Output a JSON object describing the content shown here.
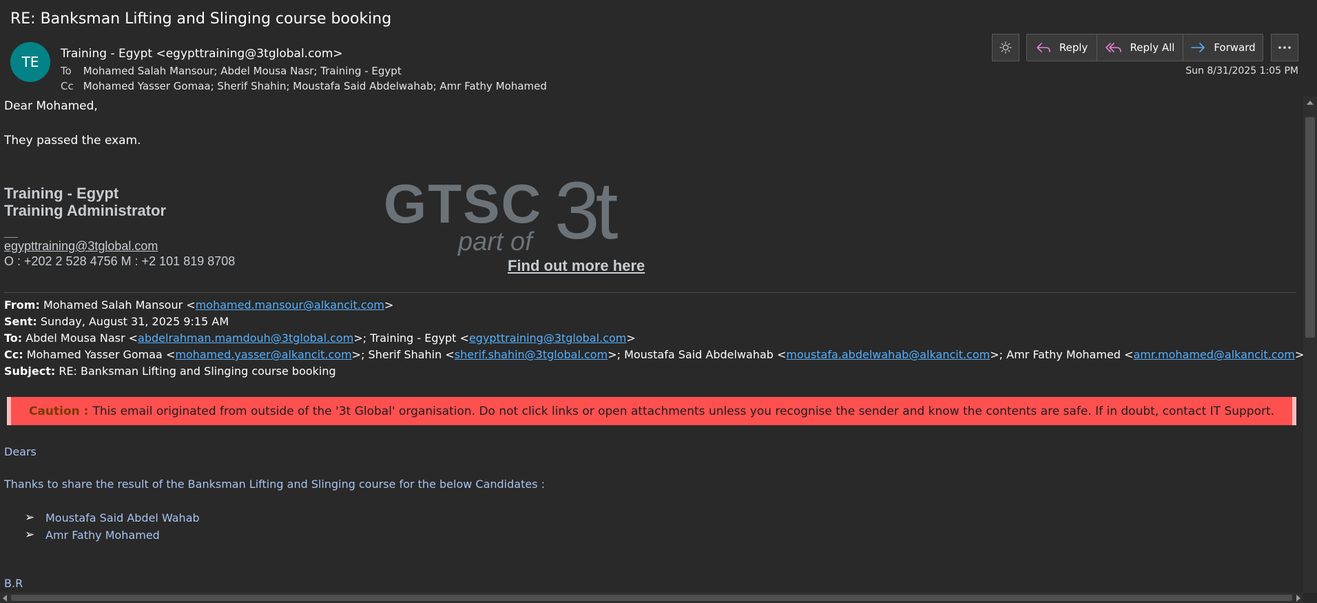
{
  "header": {
    "subject": "RE: Banksman Lifting and Slinging course booking",
    "avatar_initials": "TE",
    "avatar_color": "#038387",
    "from": "Training - Egypt <egypttraining@3tglobal.com>",
    "to_label": "To",
    "to": "Mohamed Salah Mansour; Abdel Mousa Nasr; Training - Egypt",
    "cc_label": "Cc",
    "cc": "Mohamed Yasser Gomaa; Sherif Shahin; Moustafa Said Abdelwahab; Amr Fathy Mohamed",
    "date": "Sun 8/31/2025 1:05 PM"
  },
  "actions": {
    "theme_icon": "sun-icon",
    "reply": "Reply",
    "reply_all": "Reply All",
    "forward": "Forward",
    "more_icon": "more-icon"
  },
  "body": {
    "greeting": "Dear Mohamed,",
    "line1": "They passed the exam.",
    "signature": {
      "name": "Training - Egypt",
      "title": "Training Administrator",
      "email": "egypttraining@3tglobal.com",
      "phone": "O : +202 2 528 4756 M : +2 101 819 8708",
      "logo_main": "GTSC",
      "logo_part": "part of",
      "logo_brand": "3t",
      "link": "Find out more here"
    },
    "quoted": {
      "from_label": "From:",
      "from_name": " Mohamed Salah Mansour <",
      "from_email": "mohamed.mansour@alkancit.com",
      "from_end": ">",
      "sent_label": "Sent:",
      "sent": " Sunday, August 31, 2025 9:15 AM",
      "to_label": "To:",
      "to_1_name": " Abdel Mousa Nasr <",
      "to_1_email": "abdelrahman.mamdouh@3tglobal.com",
      "to_2_name": ">; Training - Egypt <",
      "to_2_email": "egypttraining@3tglobal.com",
      "to_end": ">",
      "cc_label": "Cc:",
      "cc_1_name": " Mohamed Yasser Gomaa <",
      "cc_1_email": "mohamed.yasser@alkancit.com",
      "cc_2_name": ">; Sherif Shahin <",
      "cc_2_email": "sherif.shahin@3tglobal.com",
      "cc_3_name": ">; Moustafa Said Abdelwahab <",
      "cc_3_email": "moustafa.abdelwahab@alkancit.com",
      "cc_4_name": ">; Amr Fathy Mohamed <",
      "cc_4_email": "amr.mohamed@alkancit.com",
      "cc_end": ">",
      "subject_label": "Subject:",
      "subject": " RE: Banksman Lifting and Slinging course booking"
    },
    "caution": {
      "label": "Caution :",
      "text": "This email originated from outside of the '3t Global' organisation. Do not click links or open attachments unless you recognise the sender and know the contents are safe. If in doubt, contact IT Support.",
      "bg_color": "#ff5050"
    },
    "quoted_body": {
      "dears": "Dears",
      "thanks": "Thanks to share the result of the Banksman Lifting and Slinging course for the below Candidates :",
      "bullet": "➢",
      "candidates": [
        "Moustafa Said Abdel Wahab",
        "Amr Fathy Mohamed"
      ],
      "closing": "B.R"
    }
  }
}
